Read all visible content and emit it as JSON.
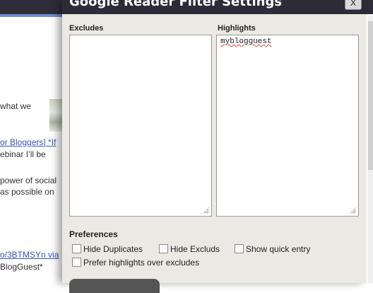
{
  "background": {
    "lines": [
      {
        "text": "what we",
        "type": "text"
      },
      {
        "text": "or Bloggers] *If",
        "type": "link_partial"
      },
      {
        "text": "ebinar I’ll be",
        "type": "text"
      },
      {
        "text": "power of social",
        "type": "text"
      },
      {
        "text": "as possible on",
        "type": "text"
      },
      {
        "text": "o/3BTMSYn via",
        "type": "link"
      },
      {
        "text": "BlogGuest*",
        "type": "text"
      }
    ]
  },
  "dialog": {
    "title": "Google Reader Filter Settings",
    "close_label": "X",
    "excludes": {
      "label": "Excludes",
      "value": ""
    },
    "highlights": {
      "label": "Highlights",
      "value": "myblogguest"
    },
    "preferences": {
      "title": "Preferences",
      "options": [
        {
          "label": "Hide Duplicates",
          "checked": false
        },
        {
          "label": "Hide Excluds",
          "checked": false
        },
        {
          "label": "Show quick entry",
          "checked": false
        },
        {
          "label": "Prefer highlights over excludes",
          "checked": false
        }
      ]
    }
  }
}
